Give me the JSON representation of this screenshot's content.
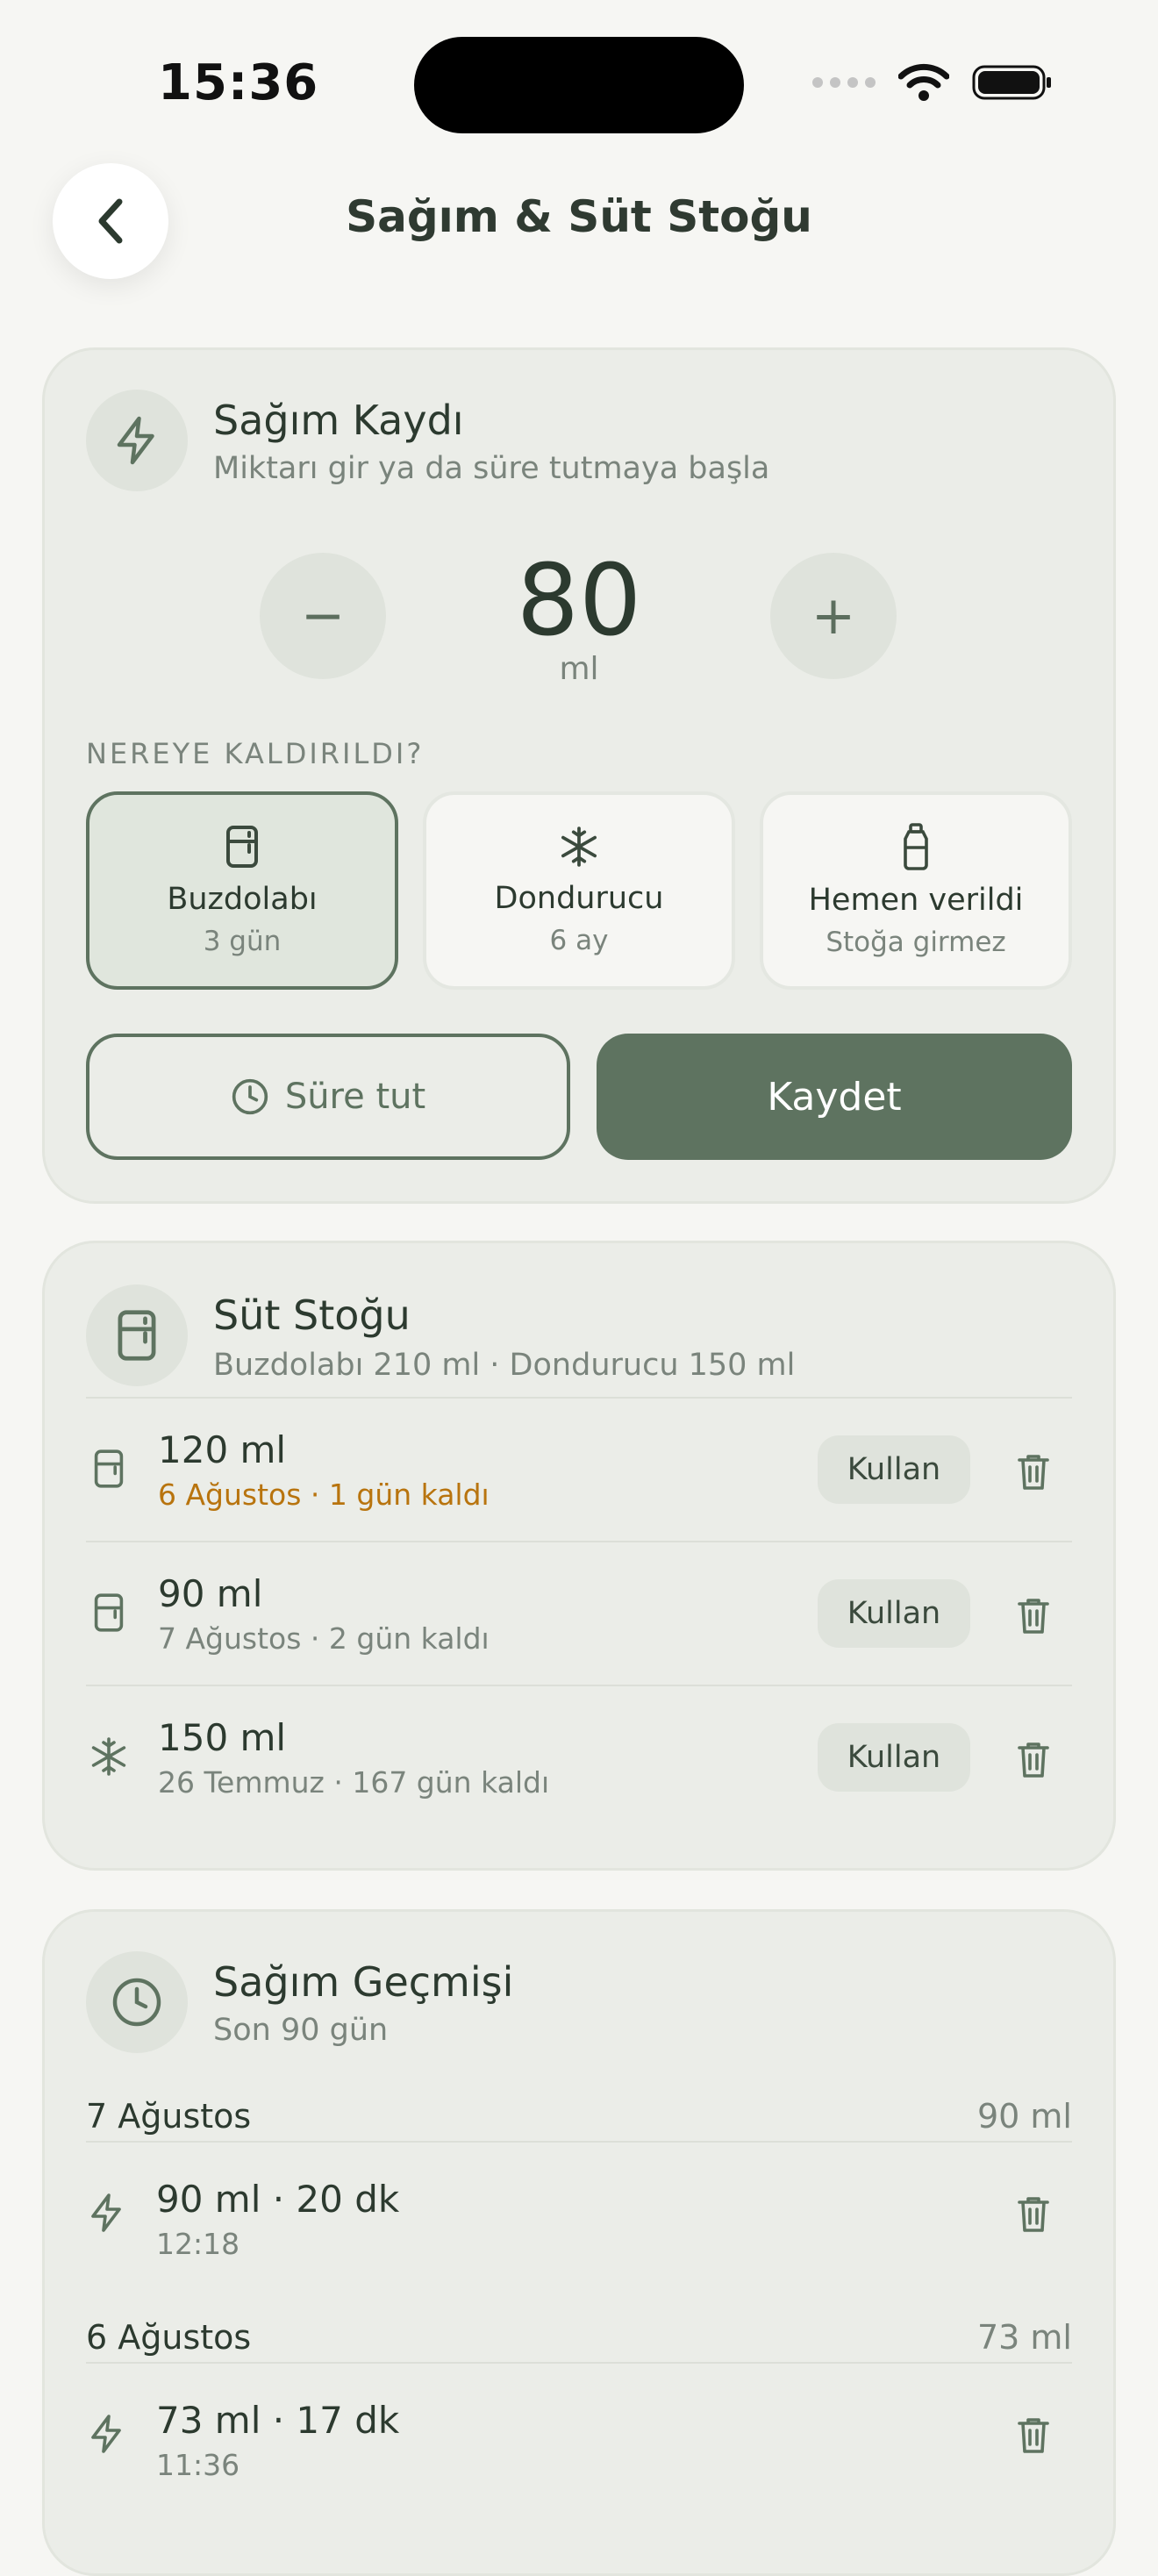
{
  "status_bar": {
    "time": "15:36"
  },
  "header": {
    "title": "Sağım & Süt Stoğu",
    "back_icon": "chevron-left-icon"
  },
  "pump_card": {
    "title": "Sağım Kaydı",
    "subtitle": "Miktarı gir ya da süre tutmaya başla",
    "amount": "80",
    "unit": "ml",
    "minus_label": "−",
    "plus_label": "+",
    "section_label": "NEREYE KALDIRILDI?",
    "locations": [
      {
        "name": "Buzdolabı",
        "sub": "3 gün",
        "icon": "fridge-icon",
        "selected": true
      },
      {
        "name": "Dondurucu",
        "sub": "6 ay",
        "icon": "snowflake-icon",
        "selected": false
      },
      {
        "name": "Hemen verildi",
        "sub": "Stoğa girmez",
        "icon": "bottle-icon",
        "selected": false
      }
    ],
    "timer_label": "Süre tut",
    "save_label": "Kaydet"
  },
  "stock_card": {
    "title": "Süt Stoğu",
    "subtitle": "Buzdolabı 210 ml · Dondurucu 150 ml",
    "items": [
      {
        "amount": "120 ml",
        "detail": "6 Ağustos · 1 gün kaldı",
        "icon": "fridge-icon",
        "warning": true,
        "use_label": "Kullan"
      },
      {
        "amount": "90 ml",
        "detail": "7 Ağustos · 2 gün kaldı",
        "icon": "fridge-icon",
        "warning": false,
        "use_label": "Kullan"
      },
      {
        "amount": "150 ml",
        "detail": "26 Temmuz · 167 gün kaldı",
        "icon": "snowflake-icon",
        "warning": false,
        "use_label": "Kullan"
      }
    ]
  },
  "history_card": {
    "title": "Sağım Geçmişi",
    "subtitle": "Son 90 gün",
    "days": [
      {
        "date": "7 Ağustos",
        "total": "90 ml",
        "entries": [
          {
            "summary": "90 ml · 20 dk",
            "time": "12:18"
          }
        ]
      },
      {
        "date": "6 Ağustos",
        "total": "73 ml",
        "entries": [
          {
            "summary": "73 ml · 17 dk",
            "time": "11:36"
          }
        ]
      }
    ]
  },
  "colors": {
    "accent": "#5e7360",
    "warning": "#b8740e",
    "card": "#ebede8",
    "background": "#f6f6f3"
  }
}
